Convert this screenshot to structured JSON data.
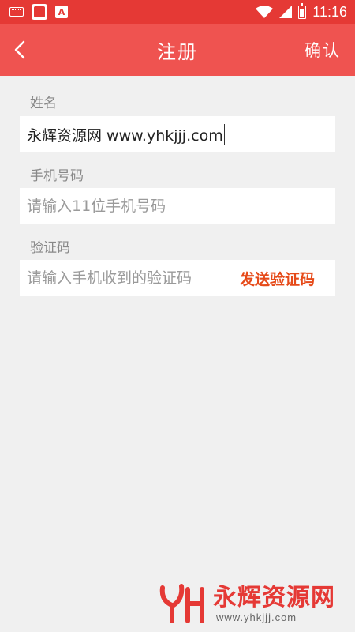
{
  "status_bar": {
    "time": "11:16",
    "icons": [
      "keyboard-icon",
      "app-notification-icon",
      "a-icon",
      "wifi-icon",
      "signal-icon",
      "battery-icon"
    ]
  },
  "app_bar": {
    "title": "注册",
    "confirm_label": "确认",
    "back_icon": "chevron-left-icon",
    "color": "#ef5350"
  },
  "form": {
    "name": {
      "label": "姓名",
      "value": "永辉资源网 www.yhkjjj.com"
    },
    "phone": {
      "label": "手机号码",
      "placeholder": "请输入11位手机号码",
      "value": ""
    },
    "code": {
      "label": "验证码",
      "placeholder": "请输入手机收到的验证码",
      "value": "",
      "send_button_label": "发送验证码",
      "send_button_color": "#e64a19"
    }
  },
  "watermark": {
    "brand": "永辉资源网",
    "url": "www.yhkjjj.com",
    "color": "#e53935"
  }
}
